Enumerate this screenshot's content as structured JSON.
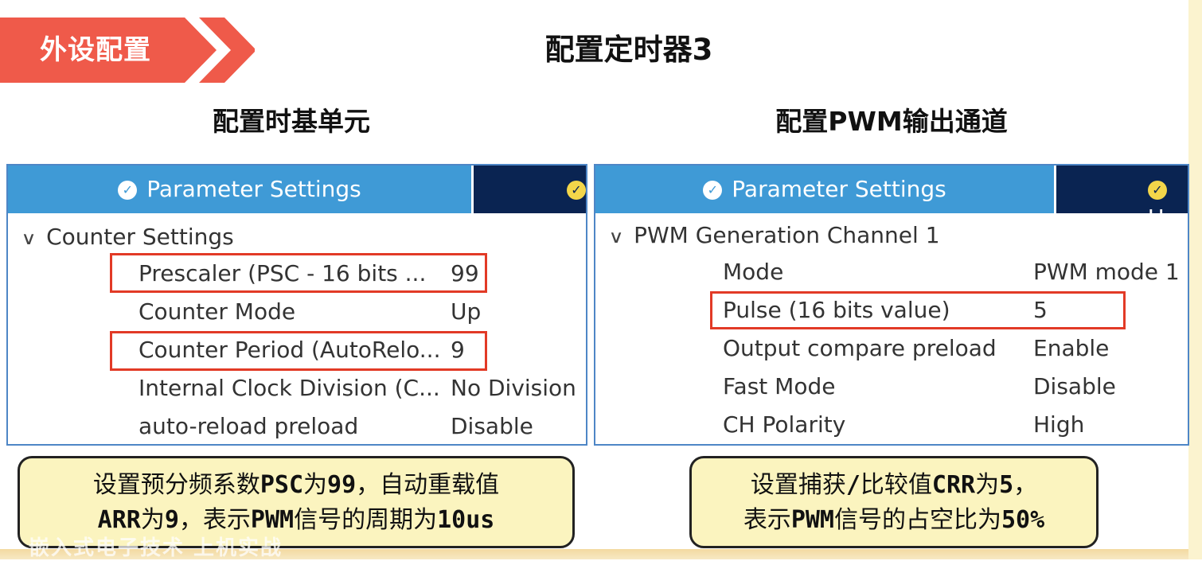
{
  "header": {
    "badge": "外设配置",
    "title": "配置定时器3"
  },
  "left": {
    "subtitle": "配置时基单元",
    "tab_active": "Parameter Settings",
    "group": "Counter Settings",
    "rows": [
      {
        "label": "Prescaler (PSC - 16 bits ...",
        "value": "99"
      },
      {
        "label": "Counter Mode",
        "value": "Up"
      },
      {
        "label": "Counter Period (AutoRelo...",
        "value": "9"
      },
      {
        "label": "Internal Clock Division (C...",
        "value": "No Division"
      },
      {
        "label": "auto-reload preload",
        "value": "Disable"
      }
    ],
    "note": {
      "line1": [
        {
          "t": "设置预分频系数",
          "b": false
        },
        {
          "t": "PSC",
          "b": true
        },
        {
          "t": "为",
          "b": false
        },
        {
          "t": "99",
          "b": true
        },
        {
          "t": "，自动重载值",
          "b": false
        }
      ],
      "line2": [
        {
          "t": "ARR",
          "b": true
        },
        {
          "t": "为",
          "b": false
        },
        {
          "t": "9",
          "b": true
        },
        {
          "t": "，表示",
          "b": false
        },
        {
          "t": "PWM",
          "b": true
        },
        {
          "t": "信号的周期为",
          "b": false
        },
        {
          "t": "10us",
          "b": true
        }
      ]
    }
  },
  "right": {
    "subtitle": "配置PWM输出通道",
    "tab_active": "Parameter Settings",
    "tab_next": "U",
    "group": "PWM Generation Channel 1",
    "rows": [
      {
        "label": "Mode",
        "value": "PWM mode 1"
      },
      {
        "label": "Pulse (16 bits value)",
        "value": "5"
      },
      {
        "label": "Output compare preload",
        "value": "Enable"
      },
      {
        "label": "Fast Mode",
        "value": "Disable"
      },
      {
        "label": "CH Polarity",
        "value": "High"
      }
    ],
    "note": {
      "line1": [
        {
          "t": "设置捕获",
          "b": false
        },
        {
          "t": "/",
          "b": true
        },
        {
          "t": "比较值",
          "b": false
        },
        {
          "t": "CRR",
          "b": true
        },
        {
          "t": "为",
          "b": false
        },
        {
          "t": "5",
          "b": true
        },
        {
          "t": "，",
          "b": false
        }
      ],
      "line2": [
        {
          "t": "表示",
          "b": false
        },
        {
          "t": "PWM",
          "b": true
        },
        {
          "t": "信号的占空比为",
          "b": false
        },
        {
          "t": "50%",
          "b": true
        }
      ]
    }
  },
  "colors": {
    "badge": "#ef5a4a",
    "tab_active": "#3f9ad6",
    "tab_bar": "#0a2452",
    "highlight": "#e23a26",
    "note_bg": "#fbf4bf"
  },
  "watermark": "嵌入式电子技术 上机实战"
}
